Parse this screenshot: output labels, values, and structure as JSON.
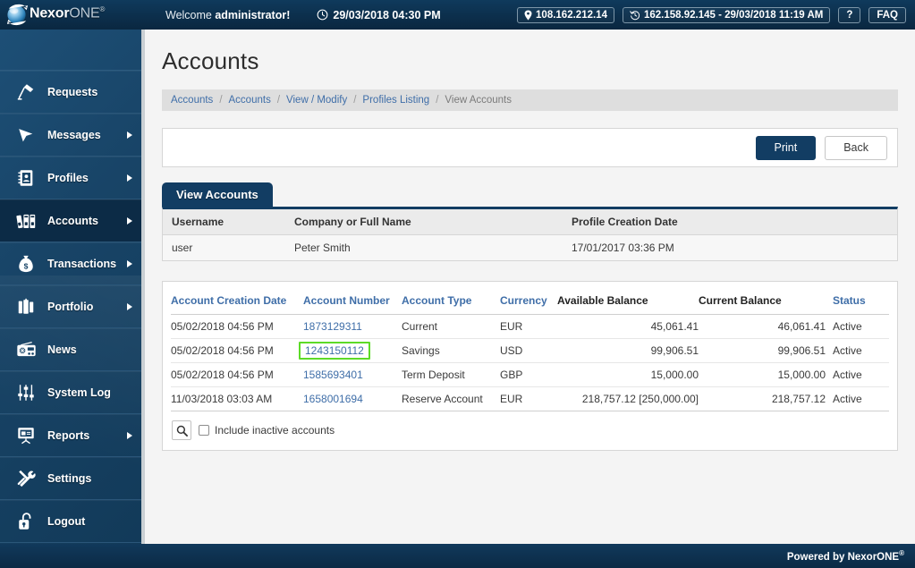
{
  "header": {
    "logo": {
      "name_bold": "Nexor",
      "name_light": "ONE",
      "registered": "®",
      "icon": "sphere-swoosh-logo"
    },
    "welcome_prefix": "Welcome ",
    "welcome_user": "administrator!",
    "datetime": "29/03/2018 04:30 PM",
    "clock_icon": "clock-icon",
    "location_icon": "location-pin-icon",
    "history_icon": "history-clock-icon",
    "current_ip": "108.162.212.14",
    "last_login": "162.158.92.145 - 29/03/2018 11:19 AM",
    "help_label": "?",
    "faq_label": "FAQ"
  },
  "sidebar": {
    "items": [
      {
        "label": "Requests",
        "icon": "desk-lamp-icon",
        "has_submenu": false,
        "active": false
      },
      {
        "label": "Messages",
        "icon": "cursor-arrow-icon",
        "has_submenu": true,
        "active": false
      },
      {
        "label": "Profiles",
        "icon": "address-book-icon",
        "has_submenu": true,
        "active": false
      },
      {
        "label": "Accounts",
        "icon": "binders-icon",
        "has_submenu": true,
        "active": true
      },
      {
        "label": "Transactions",
        "icon": "money-bag-icon",
        "has_submenu": true,
        "active": false
      },
      {
        "label": "Portfolio",
        "icon": "briefcase-icon",
        "has_submenu": true,
        "active": false
      },
      {
        "label": "News",
        "icon": "radio-icon",
        "has_submenu": false,
        "active": false
      },
      {
        "label": "System Log",
        "icon": "sliders-icon",
        "has_submenu": false,
        "active": false
      },
      {
        "label": "Reports",
        "icon": "presentation-icon",
        "has_submenu": true,
        "active": false
      },
      {
        "label": "Settings",
        "icon": "tools-icon",
        "has_submenu": false,
        "active": false
      },
      {
        "label": "Logout",
        "icon": "unlock-icon",
        "has_submenu": false,
        "active": false
      }
    ]
  },
  "page": {
    "title": "Accounts",
    "breadcrumb": [
      {
        "label": "Accounts",
        "current": false
      },
      {
        "label": "Accounts",
        "current": false
      },
      {
        "label": "View / Modify",
        "current": false
      },
      {
        "label": "Profiles Listing",
        "current": false
      },
      {
        "label": "View Accounts",
        "current": true
      }
    ],
    "actions": {
      "print_label": "Print",
      "back_label": "Back"
    },
    "tab_label": "View Accounts"
  },
  "profile": {
    "columns": [
      "Username",
      "Company or Full Name",
      "Profile Creation Date"
    ],
    "row": {
      "username": "user",
      "full_name": "Peter Smith",
      "creation_date": "17/01/2017 03:36 PM"
    }
  },
  "accounts": {
    "columns": [
      {
        "label": "Account Creation Date",
        "sortable": true,
        "align": "left"
      },
      {
        "label": "Account Number",
        "sortable": true,
        "align": "left"
      },
      {
        "label": "Account Type",
        "sortable": true,
        "align": "left"
      },
      {
        "label": "Currency",
        "sortable": true,
        "align": "left"
      },
      {
        "label": "Available Balance",
        "sortable": false,
        "align": "left"
      },
      {
        "label": "Current Balance",
        "sortable": false,
        "align": "right"
      },
      {
        "label": "Status",
        "sortable": true,
        "align": "left"
      }
    ],
    "rows": [
      {
        "creation_date": "05/02/2018 04:56 PM",
        "number": "1873129311",
        "type": "Current",
        "currency": "EUR",
        "available_balance": "45,061.41",
        "current_balance": "46,061.41",
        "status": "Active",
        "highlighted": false
      },
      {
        "creation_date": "05/02/2018 04:56 PM",
        "number": "1243150112",
        "type": "Savings",
        "currency": "USD",
        "available_balance": "99,906.51",
        "current_balance": "99,906.51",
        "status": "Active",
        "highlighted": true
      },
      {
        "creation_date": "05/02/2018 04:56 PM",
        "number": "1585693401",
        "type": "Term Deposit",
        "currency": "GBP",
        "available_balance": "15,000.00",
        "current_balance": "15,000.00",
        "status": "Active",
        "highlighted": false
      },
      {
        "creation_date": "11/03/2018 03:03 AM",
        "number": "1658001694",
        "type": "Reserve Account",
        "currency": "EUR",
        "available_balance": "218,757.12 [250,000.00]",
        "current_balance": "218,757.12",
        "status": "Active",
        "highlighted": false
      }
    ],
    "footer": {
      "search_icon": "search-icon",
      "include_inactive_label": "Include inactive accounts",
      "include_inactive_checked": false
    }
  },
  "footer": {
    "text": "Powered by NexorONE",
    "registered": "®"
  },
  "colors": {
    "header_navy": "#0c2f4c",
    "sidebar_blue": "#184467",
    "sidebar_active": "#0c2b46",
    "accent_link": "#3f6ea8",
    "tab_navy": "#123d63",
    "highlight_green": "#5cdb27",
    "content_bg": "#f4f4f4"
  }
}
